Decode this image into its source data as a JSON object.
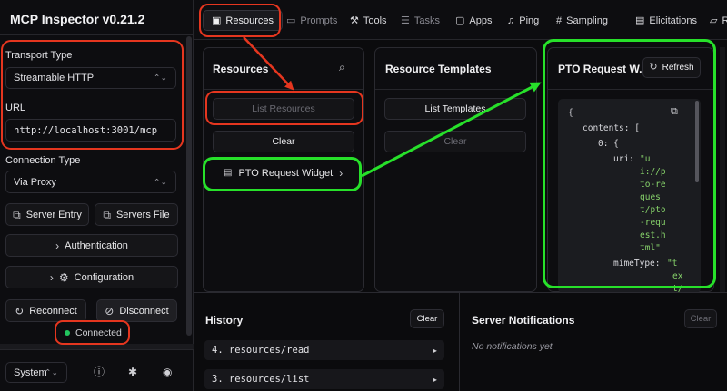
{
  "sidebar": {
    "app_title": "MCP Inspector v0.21.2",
    "transport_label": "Transport Type",
    "transport_value": "Streamable HTTP",
    "url_label": "URL",
    "url_value": "http://localhost:3001/mcp",
    "connection_label": "Connection Type",
    "connection_value": "Via Proxy",
    "server_entry_label": "Server Entry",
    "servers_file_label": "Servers File",
    "authentication_label": "Authentication",
    "configuration_label": "Configuration",
    "reconnect_label": "Reconnect",
    "disconnect_label": "Disconnect",
    "status_text": "Connected",
    "theme_value": "System"
  },
  "tabs": [
    {
      "label": "Resources",
      "icon": "file-icon"
    },
    {
      "label": "Prompts",
      "icon": "message-icon"
    },
    {
      "label": "Tools",
      "icon": "wrench-icon"
    },
    {
      "label": "Tasks",
      "icon": "list-icon"
    },
    {
      "label": "Apps",
      "icon": "app-window-icon"
    },
    {
      "label": "Ping",
      "icon": "bell-icon"
    },
    {
      "label": "Sampling",
      "icon": "hash-icon"
    },
    {
      "label": "Elicitations",
      "icon": "inbox-icon"
    },
    {
      "label": "Ro",
      "icon": "folder-icon"
    }
  ],
  "resources_panel": {
    "title": "Resources",
    "list_button": "List Resources",
    "clear_button": "Clear",
    "item_label": "PTO Request Widget"
  },
  "templates_panel": {
    "title": "Resource Templates",
    "list_button": "List Templates",
    "clear_button": "Clear"
  },
  "detail_panel": {
    "title": "PTO Request W...",
    "refresh_button": "Refresh",
    "json": {
      "l1": "{",
      "l2_key": "contents: [",
      "l3_key": "0: {",
      "uri_key": "uri:",
      "uri_lines": [
        "\"u",
        "i://p",
        "to-re",
        "ques",
        "t/pto",
        "-requ",
        "est.h",
        "tml\""
      ],
      "mime_key": "mimeType:",
      "mime_lines": [
        "\"t",
        "ex",
        "t/"
      ]
    }
  },
  "history": {
    "title": "History",
    "clear_button": "Clear",
    "items": [
      "4. resources/read",
      "3. resources/list"
    ]
  },
  "notifications": {
    "title": "Server Notifications",
    "clear_button": "Clear",
    "empty_text": "No notifications yet"
  },
  "colors": {
    "annotation_red": "#e5361f",
    "annotation_green": "#27e02a",
    "status_green": "#22c55e"
  }
}
